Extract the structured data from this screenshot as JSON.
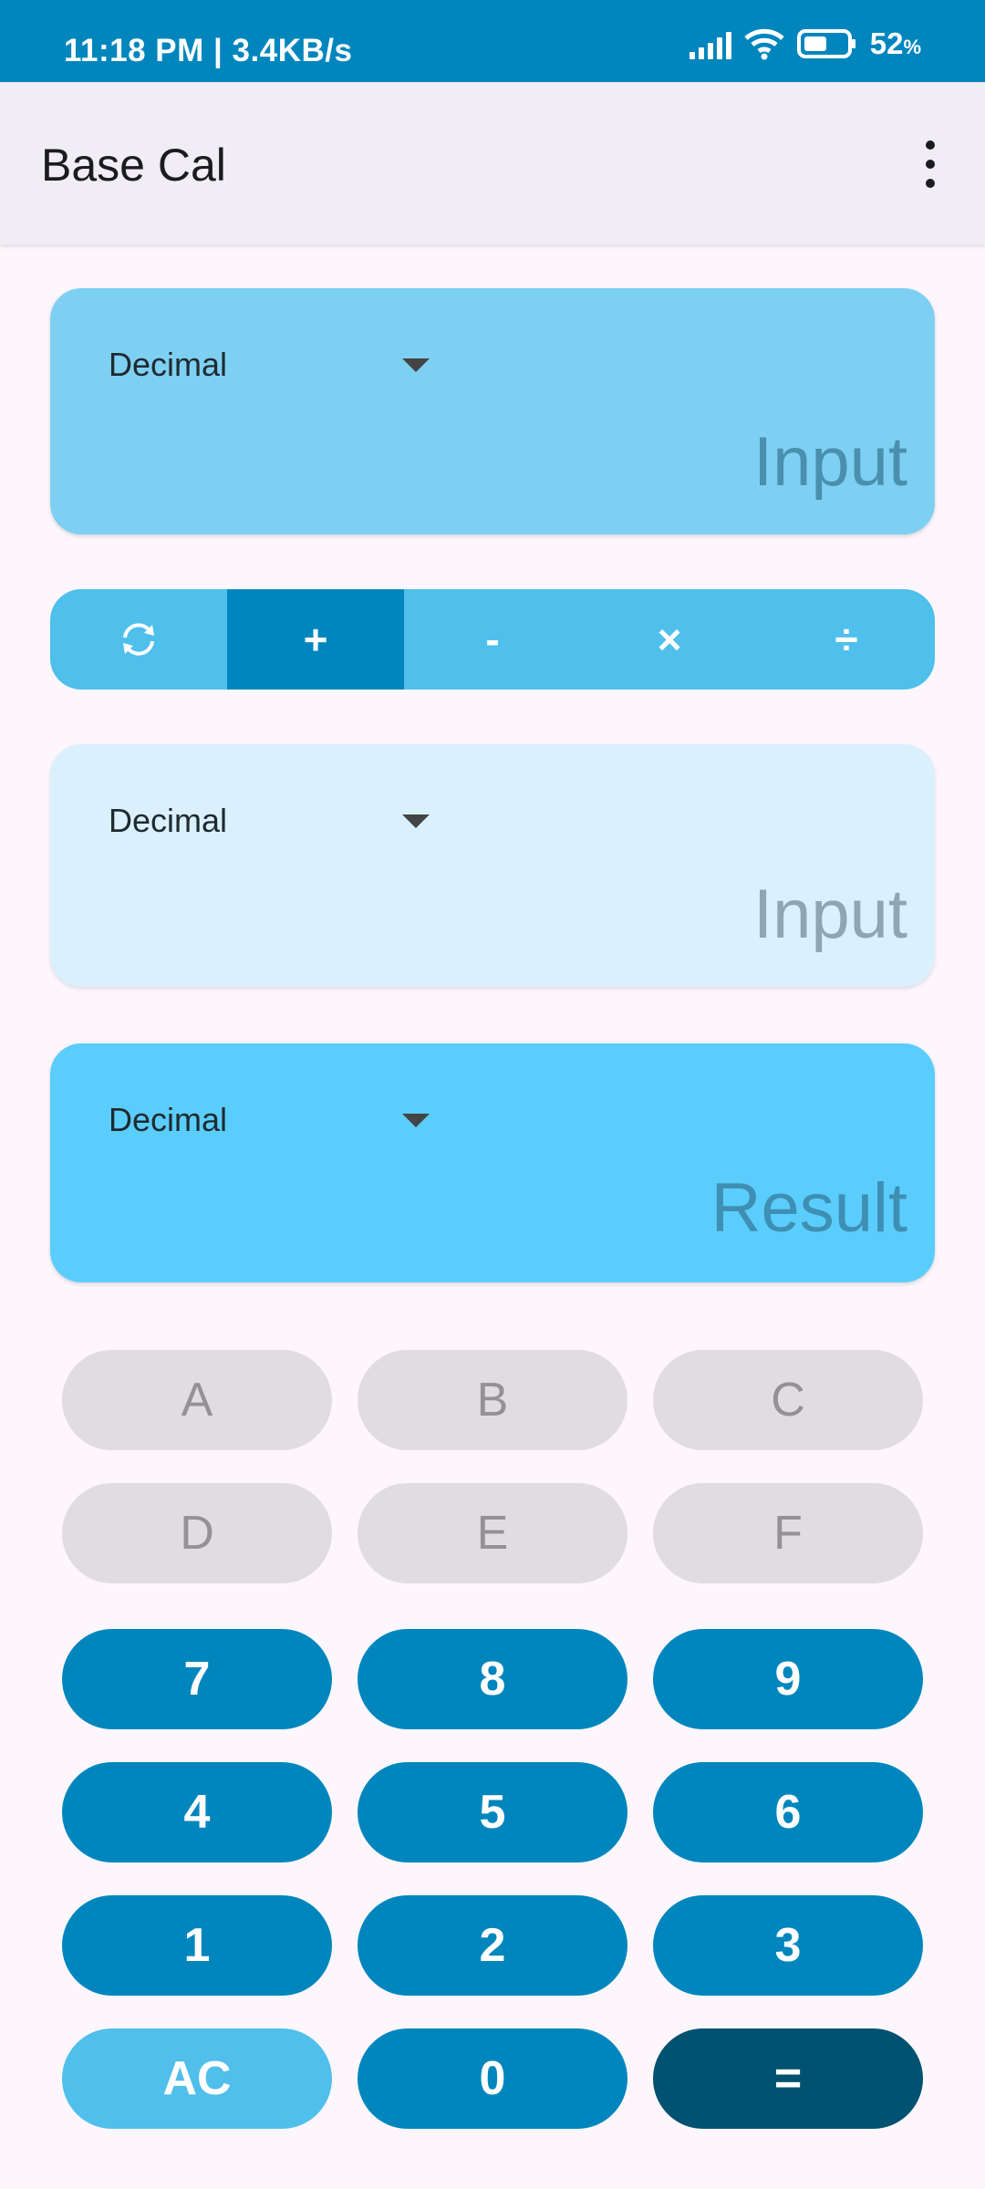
{
  "status_bar": {
    "time_speed": "11:18 PM | 3.4KB/s",
    "battery_percent": "52",
    "battery_symbol": "%"
  },
  "app_bar": {
    "title": "Base Cal",
    "menu_icon": "more-vert-icon"
  },
  "first_input": {
    "base": "Decimal",
    "placeholder": "Input"
  },
  "operations": {
    "items": [
      {
        "label": "swap-icon"
      },
      {
        "label": "+"
      },
      {
        "label": "-"
      },
      {
        "label": "×"
      },
      {
        "label": "÷"
      }
    ],
    "selected_index": 1
  },
  "second_input": {
    "base": "Decimal",
    "placeholder": "Input"
  },
  "result": {
    "base": "Decimal",
    "placeholder": "Result"
  },
  "keypad": {
    "hex_keys": [
      "A",
      "B",
      "C",
      "D",
      "E",
      "F"
    ],
    "digit_keys": [
      "7",
      "8",
      "9",
      "4",
      "5",
      "6",
      "1",
      "2",
      "3"
    ],
    "clear_label": "AC",
    "zero_label": "0",
    "equals_label": "="
  },
  "colors": {
    "status_bar": "#0086BD",
    "accent": "#0086BD",
    "equals": "#005270",
    "result_card": "#5ACDFC"
  }
}
